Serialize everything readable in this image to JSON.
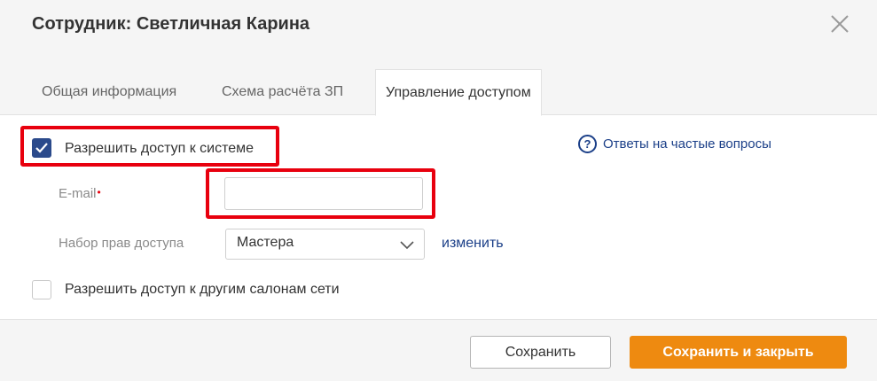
{
  "dialog": {
    "title": "Сотрудник: Светличная Карина"
  },
  "tabs": [
    {
      "label": "Общая информация",
      "active": false
    },
    {
      "label": "Схема расчёта ЗП",
      "active": false
    },
    {
      "label": "Управление доступом",
      "active": true
    }
  ],
  "access": {
    "allow_system_label": "Разрешить доступ к системе",
    "allow_system_checked": true,
    "email_label": "E-mail",
    "email_required_mark": "•",
    "email_value": "",
    "rights_label": "Набор прав доступа",
    "rights_selected": "Мастера",
    "change_link": "изменить",
    "allow_network_label": "Разрешить доступ к другим салонам сети",
    "allow_network_checked": false
  },
  "help": {
    "icon_text": "?",
    "faq_link": "Ответы на частые вопросы"
  },
  "footer": {
    "save_label": "Сохранить",
    "save_close_label": "Сохранить и закрыть"
  },
  "colors": {
    "accent_blue": "#2b4a8b",
    "link_blue": "#1b3f88",
    "primary_orange": "#ee8a10",
    "highlight_red": "#e8000e"
  },
  "icons": {
    "close": "close-icon",
    "checkmark": "checkmark-icon",
    "chevron": "chevron-down-icon",
    "help": "question-circle-icon"
  }
}
